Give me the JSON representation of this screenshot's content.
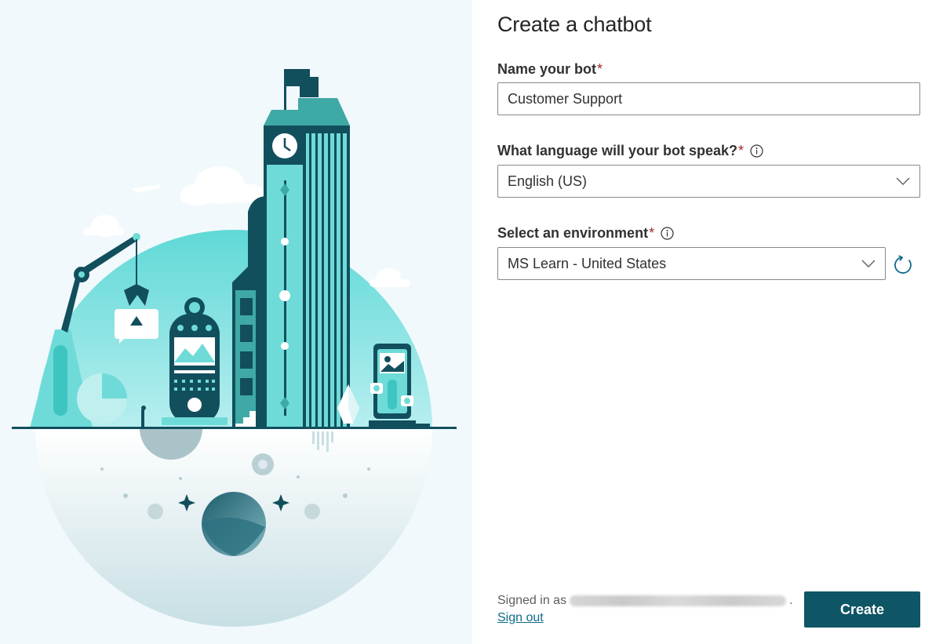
{
  "form": {
    "title": "Create a chatbot",
    "name_label": "Name your bot",
    "name_value": "Customer Support",
    "language_label": "What language will your bot speak?",
    "language_value": "English (US)",
    "environment_label": "Select an environment",
    "environment_value": "MS Learn - United States",
    "required_marker": "*"
  },
  "footer": {
    "signed_in_prefix": "Signed in as",
    "signed_in_suffix": ".",
    "sign_out_label": "Sign out",
    "create_label": "Create"
  },
  "icons": {
    "info": "info-icon",
    "dropdown": "chevron-down-icon",
    "refresh": "refresh-icon"
  },
  "colors": {
    "primary": "#0e5566",
    "link": "#0f6b8a",
    "required": "#a4262c",
    "illustration_teal": "#6fdbd8",
    "illustration_dark": "#0f4a5a"
  }
}
